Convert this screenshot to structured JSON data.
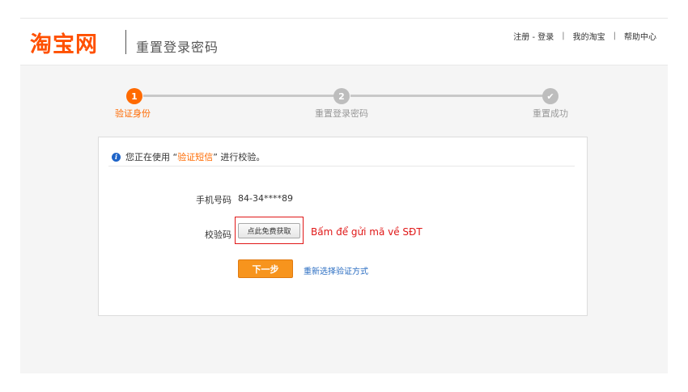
{
  "header": {
    "logo_text": "淘宝网",
    "page_title": "重置登录密码",
    "links": {
      "register_login": "注册 - 登录",
      "my_taobao": "我的淘宝",
      "help_center": "帮助中心",
      "separator": "|"
    }
  },
  "steps": [
    {
      "number": "1",
      "label": "验证身份",
      "state": "active"
    },
    {
      "number": "2",
      "label": "重置登录密码",
      "state": "inactive"
    },
    {
      "number": "✔",
      "label": "重置成功",
      "state": "inactive"
    }
  ],
  "notice": {
    "icon": "info-icon",
    "prefix": "您正在使用 “",
    "method": "验证短信",
    "suffix": "” 进行校验。"
  },
  "form": {
    "phone_label": "手机号码",
    "phone_value": "84-34****89",
    "code_label": "校验码",
    "get_code_button": "点此免费获取",
    "annotation": "Bấm để gửi mã về SĐT",
    "next_button": "下一步",
    "reselect_link": "重新选择验证方式"
  },
  "colors": {
    "brand": "#ff5000",
    "active_step": "#ff6a00",
    "next_button": "#f7941d",
    "link": "#2a6dc2",
    "annotation": "#e01818"
  }
}
